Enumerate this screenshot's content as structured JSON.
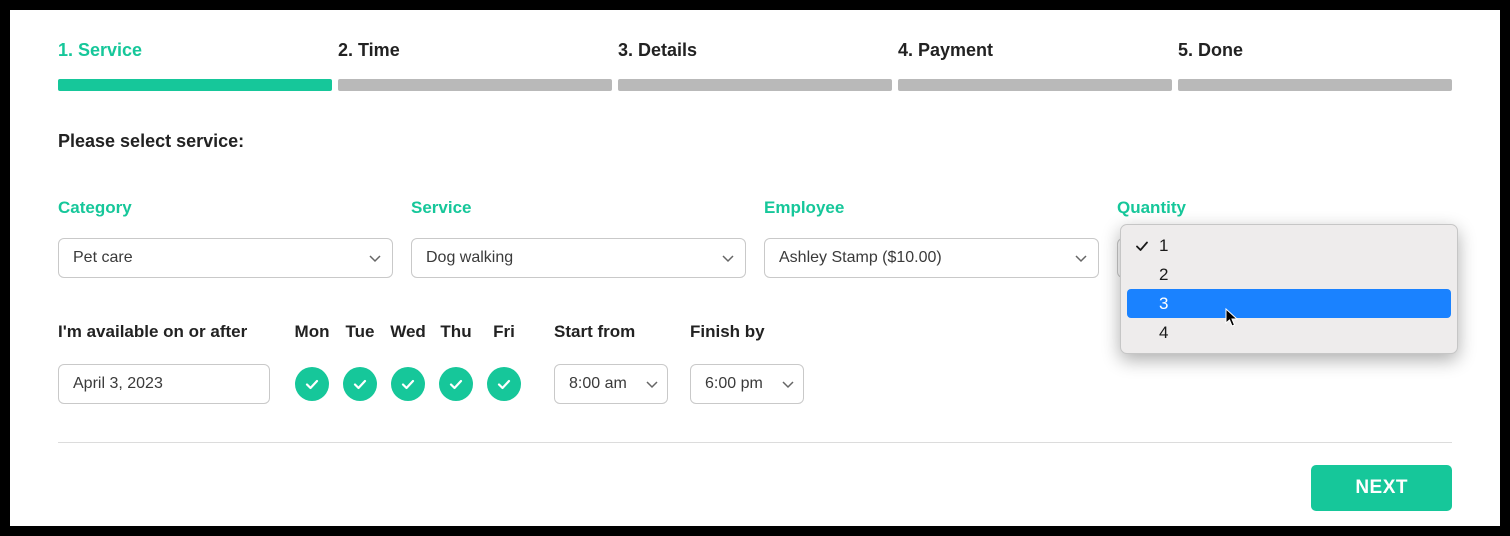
{
  "steps": [
    {
      "label": "1. Service",
      "active": true
    },
    {
      "label": "2. Time",
      "active": false
    },
    {
      "label": "3. Details",
      "active": false
    },
    {
      "label": "4. Payment",
      "active": false
    },
    {
      "label": "5. Done",
      "active": false
    }
  ],
  "prompt": "Please select service:",
  "fields": {
    "category": {
      "label": "Category",
      "value": "Pet care"
    },
    "service": {
      "label": "Service",
      "value": "Dog walking"
    },
    "employee": {
      "label": "Employee",
      "value": "Ashley Stamp ($10.00)"
    },
    "quantity": {
      "label": "Quantity",
      "value": "1",
      "options": [
        "1",
        "2",
        "3",
        "4"
      ],
      "selected_index": 0,
      "highlighted_index": 2
    }
  },
  "availability": {
    "label": "I'm available on or after",
    "date": "April 3, 2023",
    "days": [
      {
        "short": "Mon",
        "on": true
      },
      {
        "short": "Tue",
        "on": true
      },
      {
        "short": "Wed",
        "on": true
      },
      {
        "short": "Thu",
        "on": true
      },
      {
        "short": "Fri",
        "on": true
      }
    ],
    "start_label": "Start from",
    "start_value": "8:00 am",
    "finish_label": "Finish by",
    "finish_value": "6:00 pm"
  },
  "next_button": "NEXT"
}
